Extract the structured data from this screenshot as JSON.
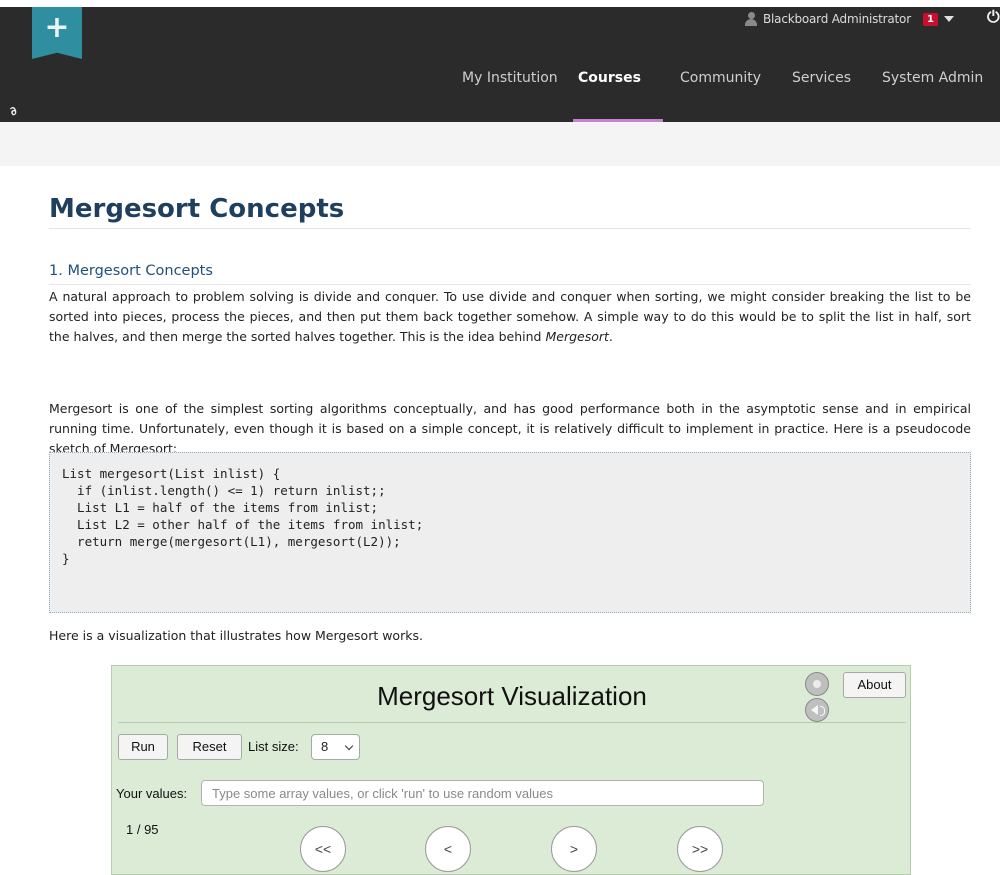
{
  "header": {
    "user_name": "Blackboard Administrator",
    "notification_count": "1",
    "nav": [
      {
        "label": "My Institution",
        "active": false
      },
      {
        "label": "Courses",
        "active": true
      },
      {
        "label": "Community",
        "active": false
      },
      {
        "label": "Services",
        "active": false
      },
      {
        "label": "System Admin",
        "active": false
      }
    ],
    "accent_color": "#c97fd3",
    "brand_color": "#2f8ea0",
    "icons": [
      "plus-icon",
      "user-icon",
      "caret-down-icon",
      "power-icon",
      "link-icon"
    ]
  },
  "content": {
    "page_title": "Mergesort Concepts",
    "section_heading": "1. Mergesort Concepts",
    "paragraph1_text": "A natural approach to problem solving is divide and conquer. To use divide and conquer when sorting, we might consider breaking the list to be sorted into pieces, process the pieces, and then put them back together somehow. A simple way to do this would be to split the list in half, sort the halves, and then merge the sorted halves together. This is the idea behind ",
    "paragraph1_emphasis": "Mergesort",
    "paragraph1_end": ".",
    "paragraph2": "Mergesort is one of the simplest sorting algorithms conceptually, and has good performance both in the asymptotic sense and in empirical running time. Unfortunately, even though it is based on a simple concept, it is relatively difficult to implement in practice. Here is a pseudocode sketch of Mergesort:",
    "code": "List mergesort(List inlist) {\n  if (inlist.length() <= 1) return inlist;;\n  List L1 = half of the items from inlist;\n  List L2 = other half of the items from inlist;\n  return merge(mergesort(L1), mergesort(L2));\n}",
    "paragraph3": "Here is a visualization that illustrates how Mergesort works."
  },
  "visualization": {
    "title": "Mergesort Visualization",
    "about_label": "About",
    "run_label": "Run",
    "reset_label": "Reset",
    "list_size_label": "List size:",
    "list_size_value": "8",
    "values_label": "Your values:",
    "values_placeholder": "Type some array values, or click 'run' to use random values",
    "step_counter": "1 / 95",
    "nav_first": "<<",
    "nav_prev": "<",
    "nav_next": ">",
    "nav_last": ">>",
    "background_color": "#dcebd6"
  }
}
